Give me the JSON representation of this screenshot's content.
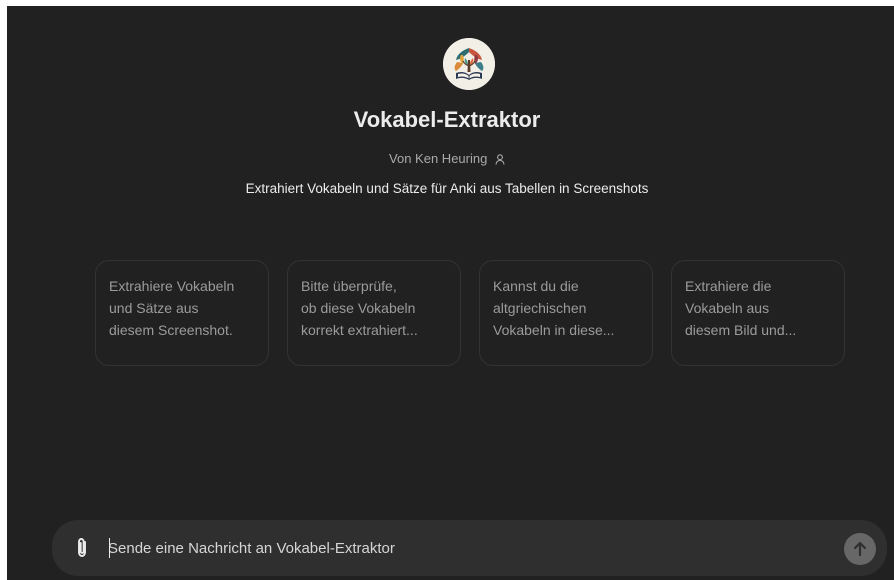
{
  "gpt": {
    "title": "Vokabel-Extraktor",
    "author": "Von Ken Heuring",
    "author_icon": "person-icon",
    "description": "Extrahiert Vokabeln und Sätze für Anki aus Tabellen in Screenshots",
    "avatar_icon": "tree-book-logo"
  },
  "suggestions": [
    {
      "lines": [
        "Extrahiere Vokabeln",
        "und Sätze aus",
        "diesem Screenshot."
      ]
    },
    {
      "lines": [
        "Bitte überprüfe,",
        "ob diese Vokabeln",
        "korrekt extrahiert..."
      ]
    },
    {
      "lines": [
        "Kannst du die",
        "altgriechischen",
        "Vokabeln in diese..."
      ]
    },
    {
      "lines": [
        "Extrahiere die",
        "Vokabeln aus",
        "diesem Bild und..."
      ]
    }
  ],
  "composer": {
    "placeholder": "Sende eine Nachricht an Vokabel-Extraktor",
    "value": "",
    "attach_icon": "paperclip-icon",
    "send_icon": "arrow-up-icon"
  },
  "colors": {
    "background": "#212121",
    "composer": "#2f2f2f",
    "send_button": "#676767",
    "text_primary": "#ececec",
    "text_muted": "#9b9b9b"
  }
}
